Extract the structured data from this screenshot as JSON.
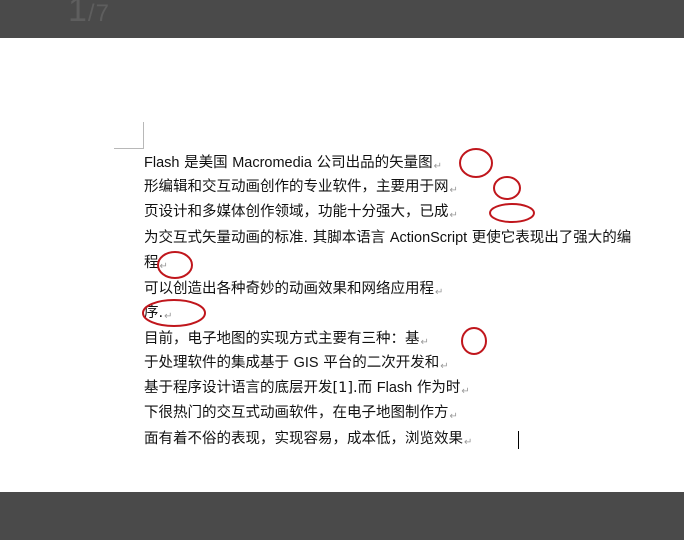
{
  "viewer": {
    "page_current": "1",
    "page_separator": "/",
    "page_total": "7"
  },
  "document": {
    "lines": [
      {
        "parts": [
          "Flash",
          " 是美国 ",
          "Macromedia",
          " 公司出品的矢量图"
        ],
        "mark": "↵"
      },
      {
        "parts": [
          "形编辑和交互动画创作的专业软件，主要用于网"
        ],
        "mark": "↵"
      },
      {
        "parts": [
          "页设计和多媒体创作领域，功能十分强大，已成"
        ],
        "mark": "↵"
      },
      {
        "parts": [
          "为交互式矢量动画的标准. 其脚本语言 ",
          "ActionScript",
          " 更使它表现出了强大的编"
        ],
        "mark": ""
      },
      {
        "parts": [
          "程"
        ],
        "mark": "↵"
      },
      {
        "parts": [
          "可以创造出各种奇妙的动画效果和网络应用程"
        ],
        "mark": "↵"
      },
      {
        "parts": [
          "序."
        ],
        "mark": "↵"
      },
      {
        "parts": [
          "目前，电子地图的实现方式主要有三种：基"
        ],
        "mark": "↵"
      },
      {
        "parts": [
          "于处理软件的集成基于 ",
          "GIS",
          " 平台的二次开发和"
        ],
        "mark": "↵"
      },
      {
        "parts": [
          "基于程序设计语言的底层开发[1].而 ",
          "Flash",
          " 作为时"
        ],
        "mark": "↵"
      },
      {
        "parts": [
          "下很热门的交互式动画软件，在电子地图制作方"
        ],
        "mark": "↵"
      },
      {
        "parts": [
          "面有着不俗的表现，实现容易，成本低，浏览效果"
        ],
        "mark": "↵"
      }
    ]
  },
  "annotations": {
    "ellipse_color": "#c0161c"
  },
  "colors": {
    "toolbar_bg": "#4a4a4a",
    "page_bg": "#ffffff",
    "text": "#111111",
    "para_mark": "#9a9a9a"
  }
}
